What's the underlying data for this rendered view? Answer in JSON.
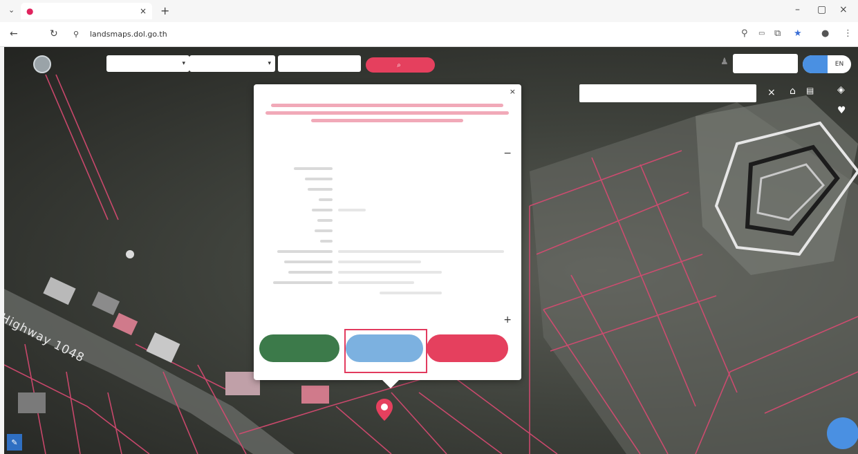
{
  "browser": {
    "tab_title": "",
    "tab_close": "×",
    "new_tab": "+",
    "url": "landsmaps.dol.go.th",
    "window_controls": [
      "–",
      "▢",
      "×"
    ]
  },
  "toolbar": {
    "brand": "",
    "province_select": "",
    "district_select": "",
    "parcel_input_placeholder": "",
    "search_label": "",
    "lang_on": "",
    "lang_off": "EN"
  },
  "map": {
    "address_search_placeholder": "",
    "road_label": "Highway 1048",
    "pin_label": "",
    "attribution": ""
  },
  "popup": {
    "close": "×",
    "section1_title": "",
    "section1_toggle": "−",
    "section2_title": "",
    "section2_toggle": "+",
    "btn_green": "",
    "btn_blue": "",
    "btn_red": ""
  },
  "colors": {
    "accent_red": "#e5405e",
    "accent_blue": "#4a90e2",
    "green": "#3c7a4a",
    "highlight": "#e23a5e"
  }
}
